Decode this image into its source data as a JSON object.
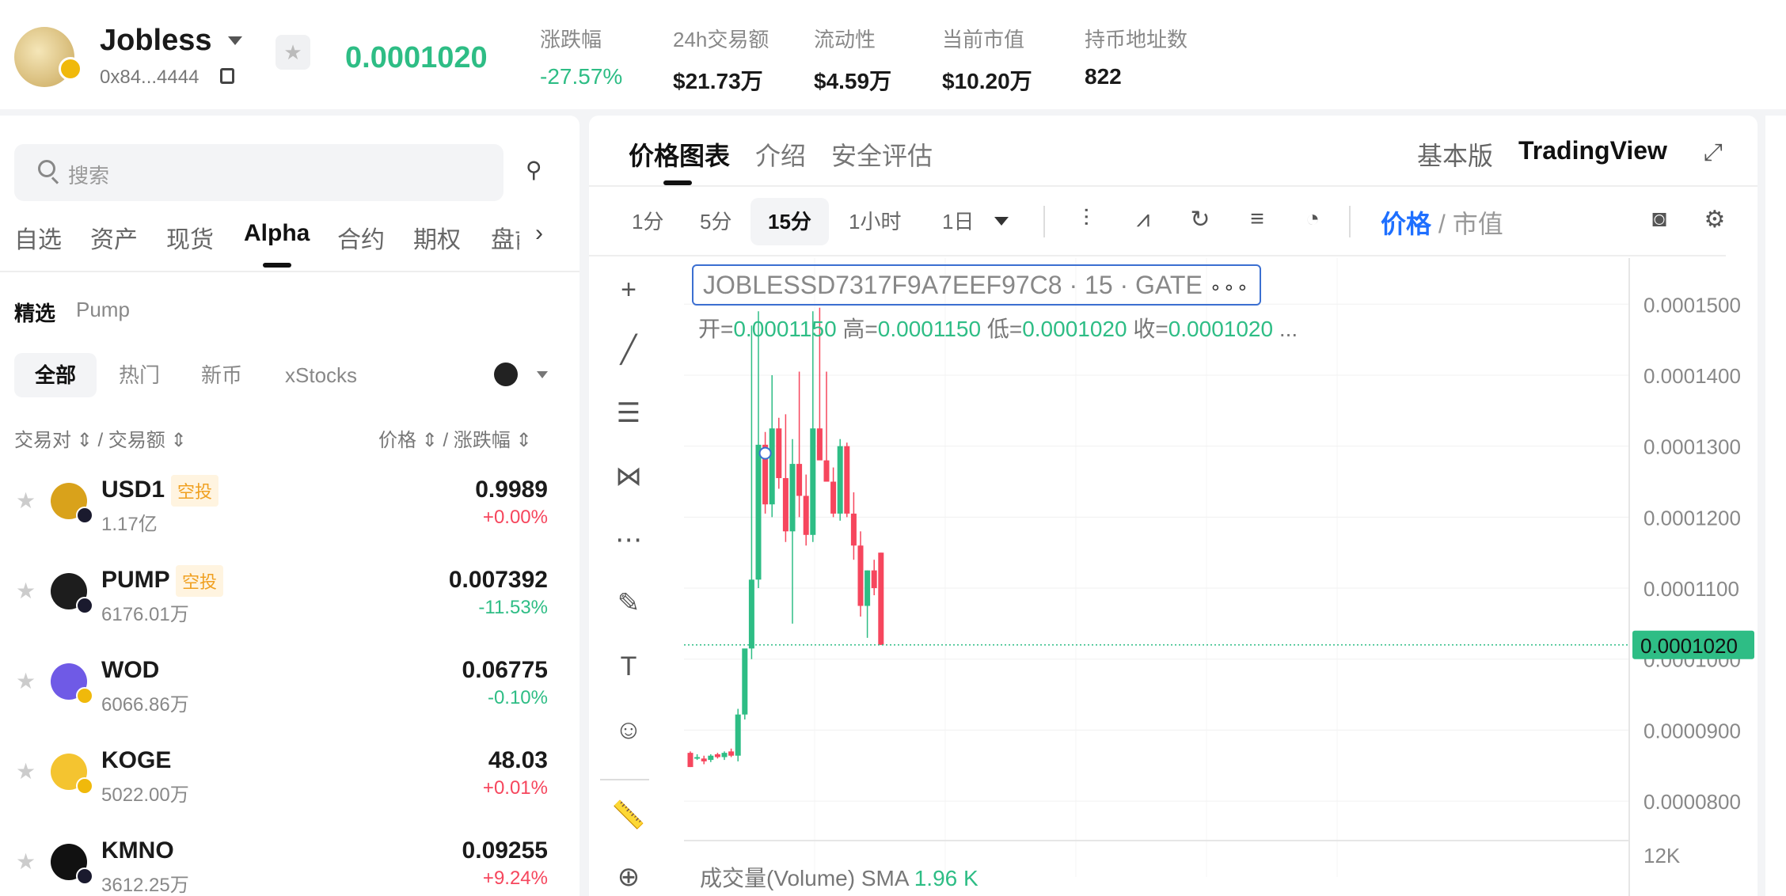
{
  "header": {
    "token_name": "Jobless",
    "token_address": "0x84...4444",
    "price": "0.0001020",
    "stats": [
      {
        "label": "涨跌幅",
        "value": "-27.57%",
        "color": "#2ebd85"
      },
      {
        "label": "24h交易额",
        "value": "$21.73万"
      },
      {
        "label": "流动性",
        "value": "$4.59万"
      },
      {
        "label": "当前市值",
        "value": "$10.20万"
      },
      {
        "label": "持币地址数",
        "value": "822"
      }
    ]
  },
  "left": {
    "search_placeholder": "搜索",
    "nav_tabs": [
      "自选",
      "资产",
      "现货",
      "Alpha",
      "合约",
      "期权",
      "盘前"
    ],
    "active_nav": "Alpha",
    "sub_tabs": [
      "精选",
      "Pump"
    ],
    "filter_tabs": [
      "全部",
      "热门",
      "新币",
      "xStocks"
    ],
    "col_pair": "交易对",
    "col_volume": "/ 交易额",
    "col_price": "价格",
    "col_change": "/ 涨跌幅",
    "rows": [
      {
        "symbol": "USD1",
        "tag": "空投",
        "volume": "1.17亿",
        "price": "0.9989",
        "change": "+0.00%",
        "dir": "down"
      },
      {
        "symbol": "PUMP",
        "tag": "空投",
        "volume": "6176.01万",
        "price": "0.007392",
        "change": "-11.53%",
        "dir": "up"
      },
      {
        "symbol": "WOD",
        "tag": "",
        "volume": "6066.86万",
        "price": "0.06775",
        "change": "-0.10%",
        "dir": "up"
      },
      {
        "symbol": "KOGE",
        "tag": "",
        "volume": "5022.00万",
        "price": "48.03",
        "change": "+0.01%",
        "dir": "down"
      },
      {
        "symbol": "KMNO",
        "tag": "",
        "volume": "3612.25万",
        "price": "0.09255",
        "change": "+9.24%",
        "dir": "down"
      }
    ]
  },
  "chart_panel": {
    "tabs": [
      "价格图表",
      "介绍",
      "安全评估"
    ],
    "view_basic": "基本版",
    "view_tv": "TradingView",
    "timeframes": [
      "1分",
      "5分",
      "15分",
      "1小时",
      "1日"
    ],
    "active_tf": "15分",
    "pm_price": "价格",
    "pm_sep": " / ",
    "pm_mcap": "市值",
    "legend": "JOBLESSD7317F9A7EEF97C8 · 15 · GATE",
    "ohlc": {
      "open_label": "开=",
      "open": "0.0001150",
      "high_label": "高=",
      "high": "0.0001150",
      "low_label": "低=",
      "low": "0.0001020",
      "close_label": "收=",
      "close": "0.0001020",
      "more": "..."
    },
    "volume_label": "成交量(Volume) SMA",
    "volume_value": "1.96 K",
    "last_price_tag": "0.0001020"
  },
  "chart_data": {
    "type": "candlestick",
    "y_ticks": [
      "0.0001500",
      "0.0001400",
      "0.0001300",
      "0.0001200",
      "0.0001100",
      "0.0001000",
      "0.0000900",
      "0.0000800"
    ],
    "ylim": [
      7.6e-05,
      0.0001565
    ],
    "volume_tick": "12K",
    "last_price": 0.000102,
    "candles": [
      {
        "o": 8.68e-05,
        "h": 8.7e-05,
        "l": 8.48e-05,
        "c": 8.48e-05
      },
      {
        "o": 8.62e-05,
        "h": 8.66e-05,
        "l": 8.58e-05,
        "c": 8.62e-05
      },
      {
        "o": 8.6e-05,
        "h": 8.64e-05,
        "l": 8.52e-05,
        "c": 8.56e-05
      },
      {
        "o": 8.58e-05,
        "h": 8.66e-05,
        "l": 8.55e-05,
        "c": 8.64e-05
      },
      {
        "o": 8.66e-05,
        "h": 8.68e-05,
        "l": 8.6e-05,
        "c": 8.62e-05
      },
      {
        "o": 8.62e-05,
        "h": 8.7e-05,
        "l": 8.58e-05,
        "c": 8.68e-05
      },
      {
        "o": 8.7e-05,
        "h": 8.74e-05,
        "l": 8.62e-05,
        "c": 8.64e-05
      },
      {
        "o": 8.64e-05,
        "h": 9.3e-05,
        "l": 8.56e-05,
        "c": 9.22e-05
      },
      {
        "o": 9.22e-05,
        "h": 0.000101,
        "l": 9.15e-05,
        "c": 0.0001015
      },
      {
        "o": 0.0001015,
        "h": 0.000147,
        "l": 0.0001,
        "c": 0.0001112
      },
      {
        "o": 0.0001112,
        "h": 0.000149,
        "l": 0.00011,
        "c": 0.0001302
      },
      {
        "o": 0.0001302,
        "h": 0.000132,
        "l": 0.0001205,
        "c": 0.0001218
      },
      {
        "o": 0.0001218,
        "h": 0.00014,
        "l": 0.00012,
        "c": 0.0001325
      },
      {
        "o": 0.0001325,
        "h": 0.000134,
        "l": 0.000124,
        "c": 0.0001255
      },
      {
        "o": 0.0001255,
        "h": 0.0001345,
        "l": 0.0001165,
        "c": 0.000118
      },
      {
        "o": 0.000118,
        "h": 0.000131,
        "l": 0.000105,
        "c": 0.0001275
      },
      {
        "o": 0.0001275,
        "h": 0.0001405,
        "l": 0.00012,
        "c": 0.000123
      },
      {
        "o": 0.000123,
        "h": 0.000126,
        "l": 0.000116,
        "c": 0.0001175
      },
      {
        "o": 0.0001175,
        "h": 0.000149,
        "l": 0.0001165,
        "c": 0.0001325
      },
      {
        "o": 0.0001325,
        "h": 0.0001495,
        "l": 0.000129,
        "c": 0.000128
      },
      {
        "o": 0.000128,
        "h": 0.0001405,
        "l": 0.000125,
        "c": 0.000125
      },
      {
        "o": 0.000125,
        "h": 0.000127,
        "l": 0.00012,
        "c": 0.0001205
      },
      {
        "o": 0.0001205,
        "h": 0.000131,
        "l": 0.0001195,
        "c": 0.00013
      },
      {
        "o": 0.00013,
        "h": 0.0001305,
        "l": 0.00012,
        "c": 0.0001205
      },
      {
        "o": 0.0001205,
        "h": 0.0001235,
        "l": 0.000114,
        "c": 0.000116
      },
      {
        "o": 0.000116,
        "h": 0.000118,
        "l": 0.000106,
        "c": 0.0001075
      },
      {
        "o": 0.0001075,
        "h": 0.0001125,
        "l": 0.000103,
        "c": 0.0001125
      },
      {
        "o": 0.0001125,
        "h": 0.000114,
        "l": 0.000109,
        "c": 0.00011
      },
      {
        "o": 0.000115,
        "h": 0.000115,
        "l": 0.000102,
        "c": 0.000102
      }
    ]
  },
  "colors": {
    "up": "#2ebd85",
    "down": "#f6465d",
    "accent": "#1e6fff"
  }
}
